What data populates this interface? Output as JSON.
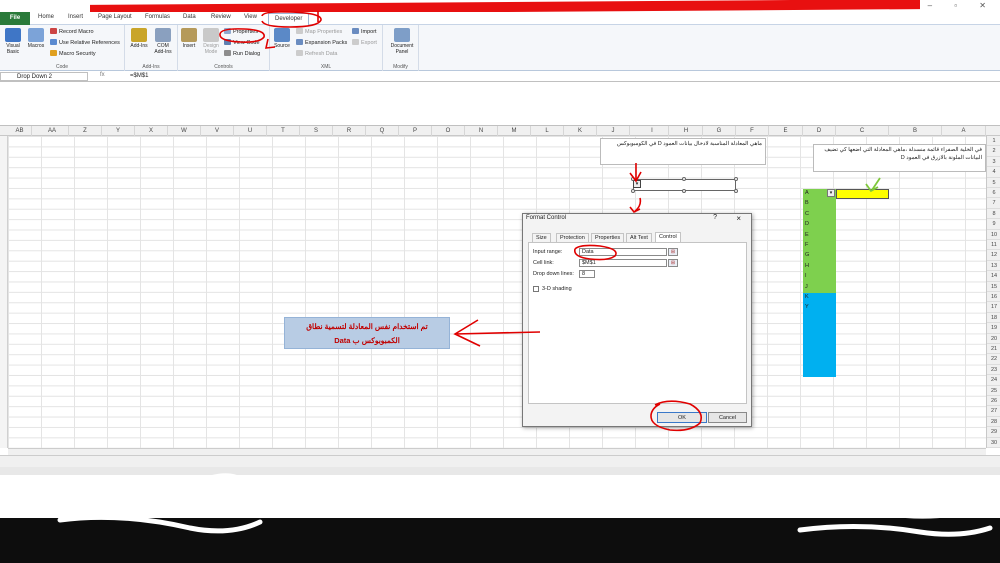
{
  "ribbon_tabs": [
    {
      "label": "File"
    },
    {
      "label": "Home"
    },
    {
      "label": "Insert"
    },
    {
      "label": "Page Layout"
    },
    {
      "label": "Formulas"
    },
    {
      "label": "Data"
    },
    {
      "label": "Review"
    },
    {
      "label": "View"
    },
    {
      "label": "Developer"
    }
  ],
  "ribbon": {
    "code": {
      "label": "Code",
      "visual_basic": "Visual Basic",
      "macros": "Macros",
      "record_macro": "Record Macro",
      "relative_refs": "Use Relative References",
      "macro_security": "Macro Security"
    },
    "addins": {
      "label": "Add-Ins",
      "addins": "Add-Ins",
      "com_addins": "COM Add-Ins"
    },
    "controls": {
      "label": "Controls",
      "insert": "Insert",
      "design_mode": "Design Mode",
      "properties": "Properties",
      "view_code": "View Code",
      "run_dialog": "Run Dialog"
    },
    "xml": {
      "label": "XML",
      "source": "Source",
      "map_properties": "Map Properties",
      "expansion_packs": "Expansion Packs",
      "refresh_data": "Refresh Data",
      "import": "Import",
      "export": "Export"
    },
    "modify": {
      "label": "Modify",
      "document_panel": "Document Panel"
    }
  },
  "formula_bar": {
    "name_box": "Drop Down 2",
    "fx": "fx",
    "formula": "=$M$1"
  },
  "column_headers": [
    "AB",
    "AA",
    "Z",
    "Y",
    "X",
    "W",
    "V",
    "U",
    "T",
    "S",
    "R",
    "Q",
    "P",
    "O",
    "N",
    "M",
    "L",
    "K",
    "J",
    "I",
    "H",
    "G",
    "F",
    "E",
    "D",
    "C",
    "B",
    "A"
  ],
  "row_numbers": [
    "1",
    "2",
    "3",
    "4",
    "5",
    "6",
    "7",
    "8",
    "9",
    "10",
    "11",
    "12",
    "13",
    "14",
    "15",
    "16",
    "17",
    "18",
    "19",
    "20",
    "21",
    "22",
    "23",
    "24",
    "25",
    "26",
    "27",
    "28",
    "29",
    "30"
  ],
  "notes": {
    "left": "ماهي المعادلة المناسبة لادخال بيانات العمود D في الكومبوبوكس",
    "right": "في الخلية الصفراء قائمة منسدلة ،ماهي المعادلة التي اضعها كي تضيف البيانات الملونة بالازرق في العمود D"
  },
  "column_d_values": [
    "A",
    "B",
    "C",
    "D",
    "E",
    "F",
    "G",
    "H",
    "I",
    "J",
    "K",
    "Y"
  ],
  "dialog": {
    "title": "Format Control",
    "help": "?",
    "close": "×",
    "tabs": [
      {
        "label": "Size"
      },
      {
        "label": "Protection"
      },
      {
        "label": "Properties"
      },
      {
        "label": "Alt Text"
      },
      {
        "label": "Control"
      }
    ],
    "input_range_label": "Input range:",
    "input_range_value": "Data",
    "cell_link_label": "Cell link:",
    "cell_link_value": "$M$1",
    "drop_lines_label": "Drop down lines:",
    "drop_lines_value": "8",
    "shading_label": "3-D shading",
    "ok": "OK",
    "cancel": "Cancel"
  },
  "callout": {
    "line1": "تم استخدام نفس المعادلة لتسمية نطاق",
    "line2": "الكمبوبوكس ب Data"
  },
  "colors": {
    "accent_red": "#e81010",
    "green_cells": "#7ed04e",
    "blue_cells": "#00b0f0",
    "yellow_cell": "#ffff00",
    "callout_bg": "#b8cce4"
  }
}
